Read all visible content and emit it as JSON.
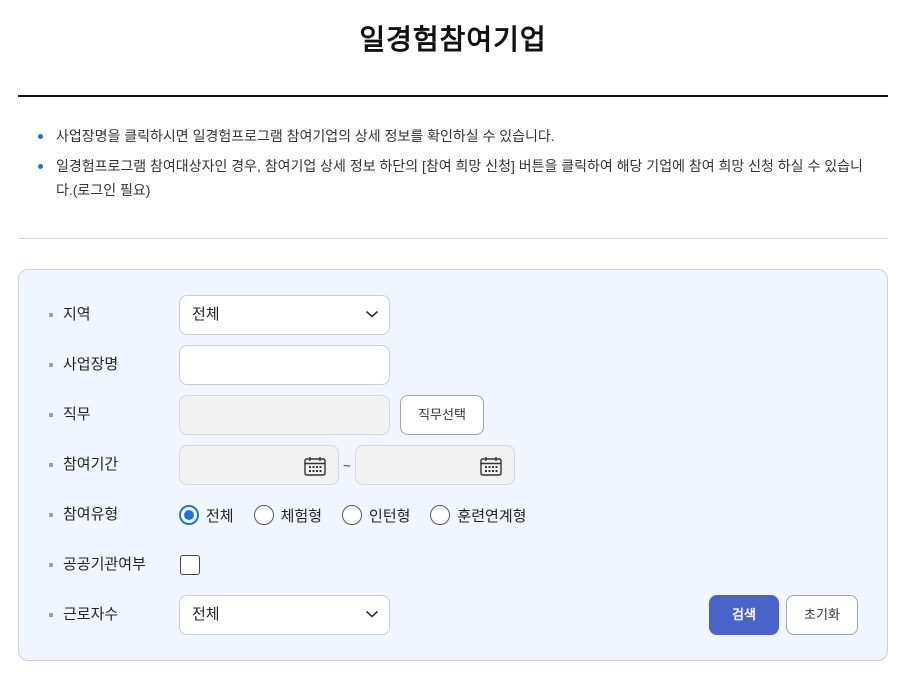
{
  "page": {
    "title": "일경험참여기업"
  },
  "notices": [
    "사업장명을 클릭하시면 일경험프로그램 참여기업의 상세 정보를 확인하실 수 있습니다.",
    "일경험프로그램 참여대상자인 경우, 참여기업 상세 정보 하단의 [참여 희망 신청] 버튼을 클릭하여 해당 기업에 참여 희망 신청 하실 수 있습니다.(로그인 필요)"
  ],
  "form": {
    "region": {
      "label": "지역",
      "value": "전체"
    },
    "company_name": {
      "label": "사업장명",
      "value": ""
    },
    "job": {
      "label": "직무",
      "value": "",
      "button": "직무선택"
    },
    "period": {
      "label": "참여기간",
      "start": "",
      "end": "",
      "separator": "~"
    },
    "type": {
      "label": "참여유형",
      "options": [
        "전체",
        "체험형",
        "인턴형",
        "훈련연계형"
      ],
      "selected": "전체"
    },
    "public_org": {
      "label": "공공기관여부",
      "checked": false
    },
    "employees": {
      "label": "근로자수",
      "value": "전체"
    },
    "search_button": "검색",
    "reset_button": "초기화"
  },
  "colors": {
    "accent": "#1f6fe5",
    "primary_button": "#4a63c8",
    "panel_bg": "#f1f5fd"
  },
  "icons": {
    "calendar": "calendar-icon",
    "dropdown": "chevron-down-icon"
  }
}
